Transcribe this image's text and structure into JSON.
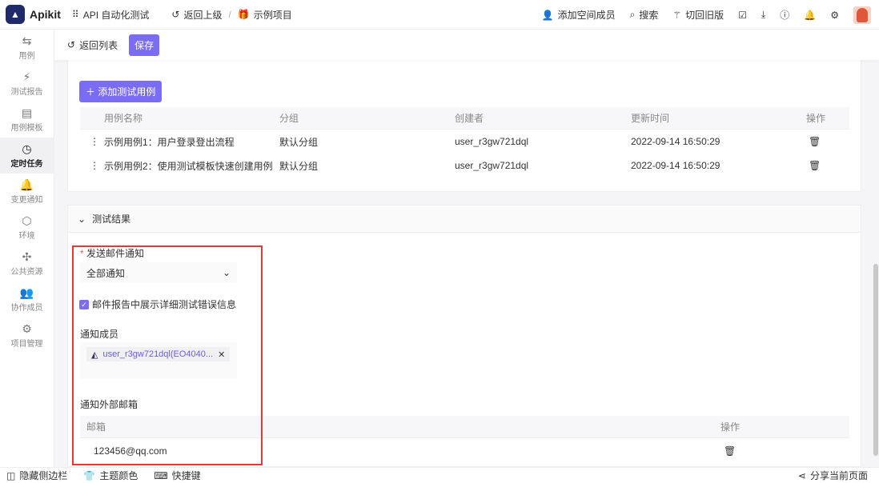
{
  "header": {
    "app": "Apikit",
    "module": "API 自动化测试",
    "back": "返回上级",
    "project": "示例项目",
    "add_member": "添加空间成员",
    "search": "搜索",
    "old_version": "切回旧版"
  },
  "sidebar": {
    "items": [
      {
        "label": "用例",
        "icon": "⇆"
      },
      {
        "label": "测试报告",
        "icon": "⚡"
      },
      {
        "label": "用例模板",
        "icon": "▤"
      },
      {
        "label": "定时任务",
        "icon": "◷"
      },
      {
        "label": "变更通知",
        "icon": "🔔"
      },
      {
        "label": "环境",
        "icon": "⬡"
      },
      {
        "label": "公共资源",
        "icon": "✣"
      },
      {
        "label": "协作成员",
        "icon": "👥"
      },
      {
        "label": "项目管理",
        "icon": "⚙"
      }
    ]
  },
  "toolbar": {
    "back_list": "返回列表",
    "save": "保存"
  },
  "cases": {
    "add_button": "添加测试用例",
    "columns": [
      "用例名称",
      "分组",
      "创建者",
      "更新时间",
      "操作"
    ],
    "rows": [
      {
        "name": "示例用例1：用户登录登出流程",
        "group": "默认分组",
        "creator": "user_r3gw721dql",
        "updated": "2022-09-14 16:50:29"
      },
      {
        "name": "示例用例2：使用测试模板快速创建用例",
        "group": "默认分组",
        "creator": "user_r3gw721dql",
        "updated": "2022-09-14 16:50:29"
      }
    ]
  },
  "result": {
    "section_title": "测试结果",
    "email_notify_label": "发送邮件通知",
    "email_notify_value": "全部通知",
    "show_detail_label": "邮件报告中展示详细测试错误信息",
    "members_label": "通知成员",
    "member_tag": "user_r3gw721dql(EO4040...",
    "external_label": "通知外部邮箱",
    "email_columns": [
      "邮箱",
      "操作"
    ],
    "emails": [
      "123456@qq.com"
    ]
  },
  "footer": {
    "hide_sidebar": "隐藏侧边栏",
    "theme": "主题颜色",
    "shortcuts": "快捷键",
    "share": "分享当前页面"
  }
}
